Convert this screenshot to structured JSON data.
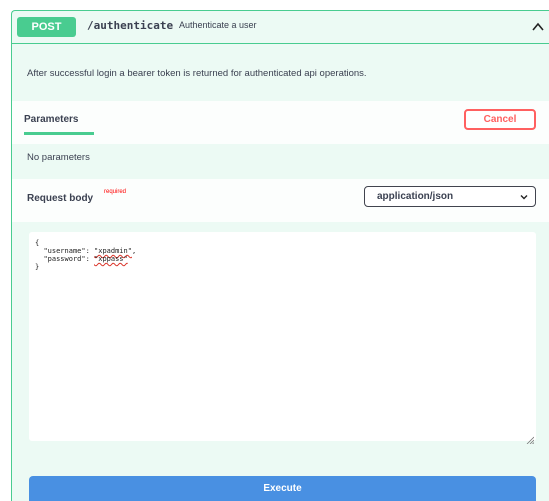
{
  "operation": {
    "method": "POST",
    "path": "/authenticate",
    "summary": "Authenticate a user",
    "description": "After successful login a bearer token is returned for authenticated api operations."
  },
  "parameters": {
    "tab_label": "Parameters",
    "cancel_label": "Cancel",
    "empty_text": "No parameters"
  },
  "request_body": {
    "label": "Request body",
    "required_label": "required",
    "content_type": "application/json",
    "body_open": "{",
    "username_key": "\"username\": ",
    "username_value": "\"xpadmin\"",
    "password_key": "\"password\": ",
    "password_value": "\"xppass\"",
    "body_close": "}"
  },
  "execute_label": "Execute",
  "colors": {
    "post_green": "#49cc90",
    "cancel_red": "#ff6060",
    "execute_blue": "#4990e2"
  },
  "icons": {
    "collapse": "chevron-up-icon",
    "select": "chevron-down-icon",
    "resize": "resize-handle-icon"
  }
}
